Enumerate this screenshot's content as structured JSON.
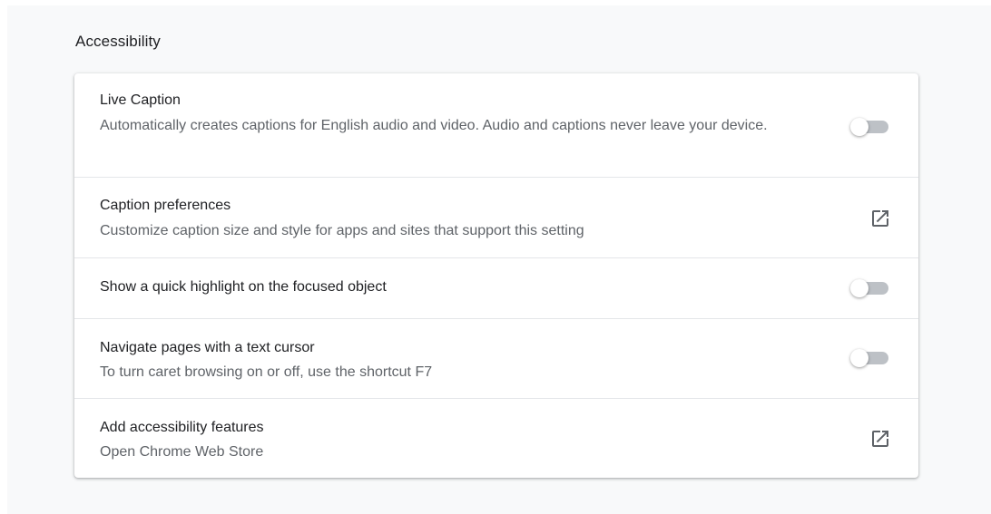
{
  "section": {
    "title": "Accessibility"
  },
  "settings": [
    {
      "label": "Live Caption",
      "sublabel": "Automatically creates captions for English audio and video. Audio and captions never leave your device.",
      "control": "toggle",
      "enabled": false
    },
    {
      "label": "Caption preferences",
      "sublabel": "Customize caption size and style for apps and sites that support this setting",
      "control": "external-link-icon"
    },
    {
      "label": "Show a quick highlight on the focused object",
      "control": "toggle",
      "enabled": false
    },
    {
      "label": "Navigate pages with a text cursor",
      "sublabel": "To turn caret browsing on or off, use the shortcut F7",
      "control": "toggle",
      "enabled": false
    },
    {
      "label": "Add accessibility features",
      "sublabel": "Open Chrome Web Store",
      "control": "external-link-icon"
    }
  ],
  "colors": {
    "page_background": "#f8f9fa",
    "card_background": "#ffffff",
    "primary_text": "#202124",
    "secondary_text": "#5f6368",
    "toggle_off_track": "#bdc1c6",
    "icon": "#5f6368"
  }
}
